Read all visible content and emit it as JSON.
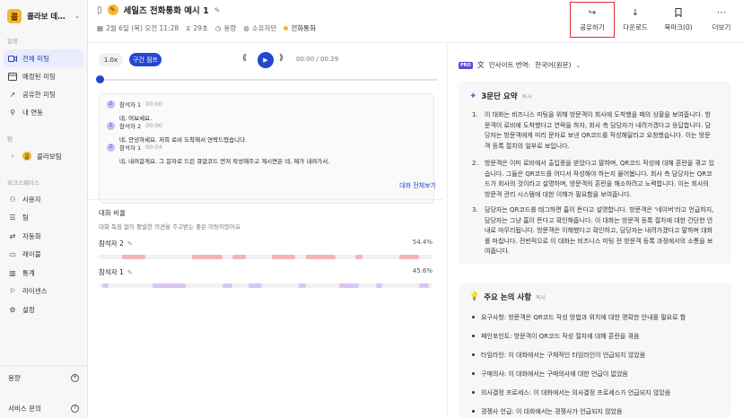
{
  "workspace": {
    "logo_char": "콜",
    "name": "콜라보 데모 워..."
  },
  "sidebar": {
    "section_main": "일정",
    "items": [
      {
        "label": "전체 미팅",
        "icon": "video-icon",
        "active": true
      },
      {
        "label": "예정된 미팅",
        "icon": "calendar-icon"
      },
      {
        "label": "공유한 미팅",
        "icon": "share-icon"
      },
      {
        "label": "내 연동",
        "icon": "link-icon"
      }
    ],
    "section_team": "팀",
    "team": {
      "label": "콜라보팀",
      "char": "콜"
    },
    "section_workspace": "워크스페이스",
    "ws_items": [
      {
        "label": "사용자",
        "icon": "user-icon"
      },
      {
        "label": "팀",
        "icon": "team-icon"
      },
      {
        "label": "자동화",
        "icon": "automation-icon"
      },
      {
        "label": "레이블",
        "icon": "label-icon"
      },
      {
        "label": "통계",
        "icon": "stats-icon"
      },
      {
        "label": "라이센스",
        "icon": "license-icon"
      },
      {
        "label": "설정",
        "icon": "gear-icon"
      }
    ],
    "bottom": {
      "usage": "용량",
      "support": "서비스 문의"
    }
  },
  "header": {
    "title": "세일즈 전화통화 예시 1",
    "date": "2월 6일 (목) 오전 11:28",
    "duration": "29초",
    "usage": "용량",
    "owner": "소유자만",
    "tag": "전화통화"
  },
  "toolbar": {
    "share": "공유하기",
    "download": "다운로드",
    "bookmark": "북마크(0)",
    "more": "더보기"
  },
  "player": {
    "speed": "1.0x",
    "skip": "구간 점프",
    "time": "00:00 / 00:29",
    "progress": 0
  },
  "transcript": {
    "utterances": [
      {
        "avatar": "2",
        "speaker": "참석자 1",
        "time": "00:00",
        "text": "네, 여보세요."
      },
      {
        "avatar": "1",
        "speaker": "참석자 2",
        "time": "00:00",
        "text": "네, 안녕하세요. 저희 로비 도착해서 연락드렸습니다."
      },
      {
        "avatar": "2",
        "speaker": "참석자 1",
        "time": "00:04",
        "text": "네, 내려갈게요. 그 문자로 드린 큐알코드 먼저 작성해주고 계시면은 네, 제가 내려가서."
      }
    ],
    "view_all": "대화 전체보기"
  },
  "ratio": {
    "title": "대화 비율",
    "subtitle": "대화 독점 없이 활발한 의견을 주고받는 좋은 미팅이었어요",
    "speakers": [
      {
        "name": "참석자 2",
        "pct": "54.4%",
        "share": 54.4,
        "color": "#f6b3b3"
      },
      {
        "name": "참석자 1",
        "pct": "45.6%",
        "share": 45.6,
        "color": "#dcc4f5"
      }
    ]
  },
  "insight": {
    "label": "인사이트 번역:",
    "language": "한국어(원문)"
  },
  "summary": {
    "title": "3문단 요약",
    "copy": "복사",
    "items": [
      {
        "num": "1.",
        "lines": [
          "이 대화는 비즈니스 미팅을 위해 방문객이 회사에 도착했을 때의 상황을 보여줍니다. 방",
          "문객이 로비에 도착했다고 연락을 하자, 회사 측 담당자가 내려가겠다고 응답합니다. 담",
          "당자는 방문객에게 미리 문자로 보낸 QR코드를 작성해달라고 요청했습니다. 이는 방문",
          "객 등록 절차의 일부로 보입니다."
        ]
      },
      {
        "num": "2.",
        "lines": [
          "방문객은 이미 로비에서 출입증을 받았다고 말하며, QR코드 작성에 대해 혼란을 겪고 있",
          "습니다. 그들은 QR코드를 어디서 작성해야 하는지 물어봅니다. 회사 측 담당자는 QR코",
          "드가 회사의 것이라고 설명하며, 방문객의 혼란을 해소하려고 노력합니다. 이는 회사의",
          "방문객 관리 시스템에 대한 이해가 필요함을 보여줍니다."
        ]
      },
      {
        "num": "3.",
        "lines": [
          "담당자는 QR코드를 태그하면 홈이 뜬다고 설명합니다. 방문객은 '네이버'라고 언급하지,",
          "담당자는 그냥 홈이 뜬다고 확인해줍니다. 이 대화는 방문객 등록 절차에 대한 간단한 안",
          "내로 마무리됩니다. 방문객은 이해했다고 확인하고, 담당자는 내려가겠다고 말하며 대화",
          "를 마칩니다. 전반적으로 이 대화는 비즈니스 미팅 전 방문객 등록 과정에서의 소통을 보",
          "여줍니다."
        ]
      }
    ]
  },
  "discussion": {
    "title": "주요 논의 사항",
    "copy": "복사",
    "items": [
      "요구사항: 방문객은 QR코드 작성 방법과 위치에 대한 명확한 안내를 필요로 함",
      "페인포인트: 방문객이 QR코드 작성 절차에 대해 혼란을 겪음",
      "타임라인: 이 대화에서는 구체적인 타임라인이 언급되지 않았음",
      "구매의사: 이 대화에서는 구매의사에 대한 언급이 없었음",
      "의사결정 프로세스: 이 대화에서는 의사결정 프로세스가 언급되지 않았음",
      "경쟁사 언급: 이 대화에서는 경쟁사가 언급되지 않았음"
    ]
  }
}
